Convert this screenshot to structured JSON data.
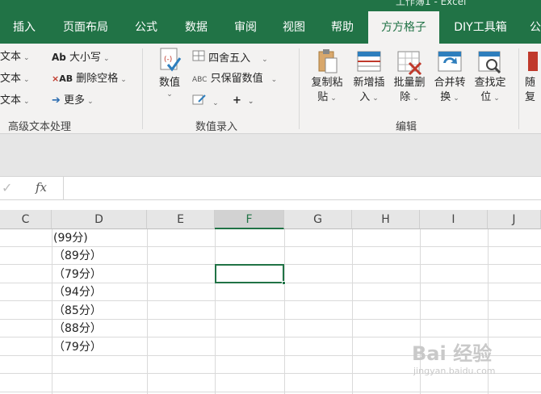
{
  "window": {
    "title_fragment": "工作簿1 - Excel"
  },
  "tabs": [
    {
      "label": "插入",
      "active": false
    },
    {
      "label": "页面布局",
      "active": false
    },
    {
      "label": "公式",
      "active": false
    },
    {
      "label": "数据",
      "active": false
    },
    {
      "label": "审阅",
      "active": false
    },
    {
      "label": "视图",
      "active": false
    },
    {
      "label": "帮助",
      "active": false
    },
    {
      "label": "方方格子",
      "active": true
    },
    {
      "label": "DIY工具箱",
      "active": false
    },
    {
      "label": "公",
      "active": false
    }
  ],
  "ribbon": {
    "text_group": {
      "items_left": [
        "文本",
        "文本",
        "文本"
      ],
      "case_label": "大小写",
      "remove_spaces_label": "删除空格",
      "more_label": "更多",
      "group_label": "高级文本处理"
    },
    "number_group": {
      "value_label": "数值",
      "round_label": "四舍五入",
      "keep_value_label": "只保留数值",
      "plus_label": "+",
      "group_label": "数值录入"
    },
    "edit_group": {
      "buttons": [
        {
          "line1": "复制粘",
          "line2": "贴"
        },
        {
          "line1": "新增插",
          "line2": "入"
        },
        {
          "line1": "批量删",
          "line2": "除"
        },
        {
          "line1": "合并转",
          "line2": "换"
        },
        {
          "line1": "查找定",
          "line2": "位"
        }
      ],
      "partial_button": {
        "line1": "随",
        "line2": "复"
      },
      "group_label": "编辑"
    }
  },
  "formula_bar": {
    "fx_label": "fx",
    "value": ""
  },
  "columns": [
    "C",
    "D",
    "E",
    "F",
    "G",
    "H",
    "I",
    "J"
  ],
  "selected_column": "F",
  "cells_d": [
    "(99分)",
    "（89分）",
    "（79分）",
    "（94分）",
    "（85分）",
    "（88分）",
    "（79分）"
  ],
  "watermark": {
    "brand": "Bai 经验",
    "url": "jingyan.baidu.com"
  },
  "colors": {
    "accent": "#217346",
    "ribbon_bg": "#f3f2f1"
  }
}
